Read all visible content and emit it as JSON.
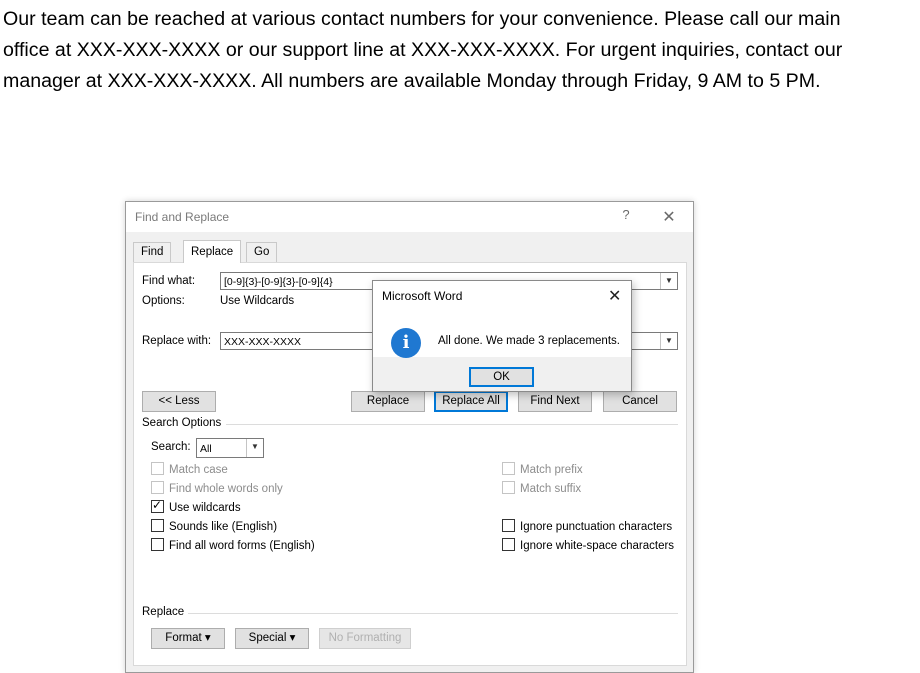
{
  "document": {
    "paragraph": "Our team can be reached at various contact numbers for your convenience. Please call our main\noffice at XXX-XXX-XXXX or our support line at XXX-XXX-XXXX. For urgent inquiries, contact our\nmanager at XXX-XXX-XXXX. All numbers are available Monday through Friday, 9 AM to 5 PM."
  },
  "dialog": {
    "title": "Find and Replace",
    "help_glyph": "?",
    "close_glyph": "✕",
    "tabs": [
      "Find",
      "Replace",
      "Go To"
    ],
    "active_tab": "Replace",
    "find_what_label": "Find what:",
    "find_what_value": "[0-9]{3}-[0-9]{3}-[0-9]{4}",
    "options_label": "Options:",
    "options_value": "Use Wildcards",
    "replace_with_label": "Replace with:",
    "replace_with_value": "XXX-XXX-XXXX",
    "buttons": {
      "less": "<< Less",
      "replace": "Replace",
      "replace_all": "Replace All",
      "find_next": "Find Next",
      "cancel": "Cancel"
    },
    "search_options_heading": "Search Options",
    "search_label": "Search:",
    "search_value": "All",
    "checkboxes": {
      "match_case": {
        "label": "Match case",
        "checked": false,
        "enabled": false
      },
      "whole_words": {
        "label": "Find whole words only",
        "checked": false,
        "enabled": false
      },
      "use_wildcards": {
        "label": "Use wildcards",
        "checked": true,
        "enabled": true
      },
      "sounds_like": {
        "label": "Sounds like (English)",
        "checked": false,
        "enabled": true
      },
      "word_forms": {
        "label": "Find all word forms (English)",
        "checked": false,
        "enabled": true
      },
      "match_prefix": {
        "label": "Match prefix",
        "checked": false,
        "enabled": false
      },
      "match_suffix": {
        "label": "Match suffix",
        "checked": false,
        "enabled": false
      },
      "ignore_punct": {
        "label": "Ignore punctuation characters",
        "checked": false,
        "enabled": true
      },
      "ignore_space": {
        "label": "Ignore white-space characters",
        "checked": false,
        "enabled": true
      }
    },
    "replace_heading": "Replace",
    "format_button": "Format ▾",
    "special_button": "Special ▾",
    "no_formatting_button": "No Formatting"
  },
  "message_box": {
    "title": "Microsoft Word",
    "close_glyph": "✕",
    "icon": "info-icon",
    "text": "All done. We made 3 replacements.",
    "ok_label": "OK"
  },
  "colors": {
    "accent": "#0078d7",
    "info_icon": "#1f78d1"
  }
}
